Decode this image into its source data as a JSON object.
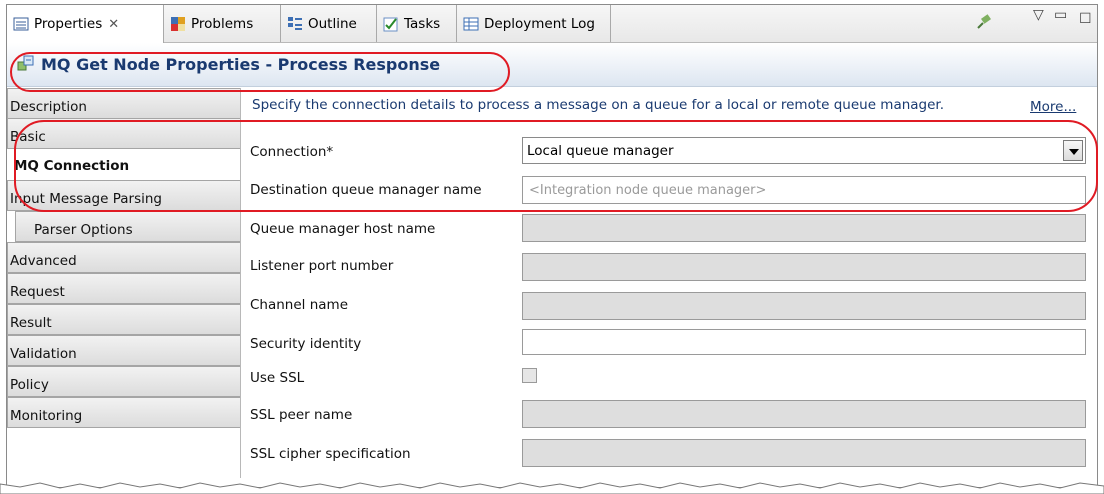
{
  "tabs": [
    {
      "label": "Properties",
      "icon": "properties-icon",
      "active": true,
      "close_glyph": "✕"
    },
    {
      "label": "Problems",
      "icon": "problems-icon"
    },
    {
      "label": "Outline",
      "icon": "outline-icon"
    },
    {
      "label": "Tasks",
      "icon": "tasks-icon"
    },
    {
      "label": "Deployment Log",
      "icon": "deployment-log-icon"
    }
  ],
  "view_controls": {
    "pin": "pin-icon",
    "menu": "▽",
    "minimize": "▭",
    "maximize": "☐"
  },
  "header": {
    "title": "MQ Get Node Properties - Process Response",
    "icon": "node-icon"
  },
  "sidebar": {
    "items": [
      {
        "label": "Description"
      },
      {
        "label": "Basic"
      },
      {
        "label": "MQ Connection",
        "selected": true
      },
      {
        "label": "Input Message Parsing"
      },
      {
        "label": "Parser Options",
        "sub": true
      },
      {
        "label": "Advanced"
      },
      {
        "label": "Request"
      },
      {
        "label": "Result"
      },
      {
        "label": "Validation"
      },
      {
        "label": "Policy"
      },
      {
        "label": "Monitoring"
      }
    ]
  },
  "main": {
    "description": "Specify the connection details to process a message on a queue for a local or remote queue manager.",
    "more_link": "More...",
    "fields": [
      {
        "label": "Connection*",
        "type": "select",
        "value": "Local queue manager"
      },
      {
        "label": "Destination queue manager name",
        "type": "text",
        "placeholder": "<Integration node queue manager>"
      },
      {
        "label": "Queue manager host name",
        "type": "disabled"
      },
      {
        "label": "Listener port number",
        "type": "disabled"
      },
      {
        "label": "Channel name",
        "type": "disabled"
      },
      {
        "label": "Security identity",
        "type": "text-enabled"
      },
      {
        "label": "Use SSL",
        "type": "checkbox"
      },
      {
        "label": "SSL peer name",
        "type": "disabled"
      },
      {
        "label": "SSL cipher specification",
        "type": "disabled"
      }
    ]
  },
  "colors": {
    "annotation": "#e01b24",
    "title_text": "#1a3a70",
    "disabled_field": "#dedede"
  }
}
